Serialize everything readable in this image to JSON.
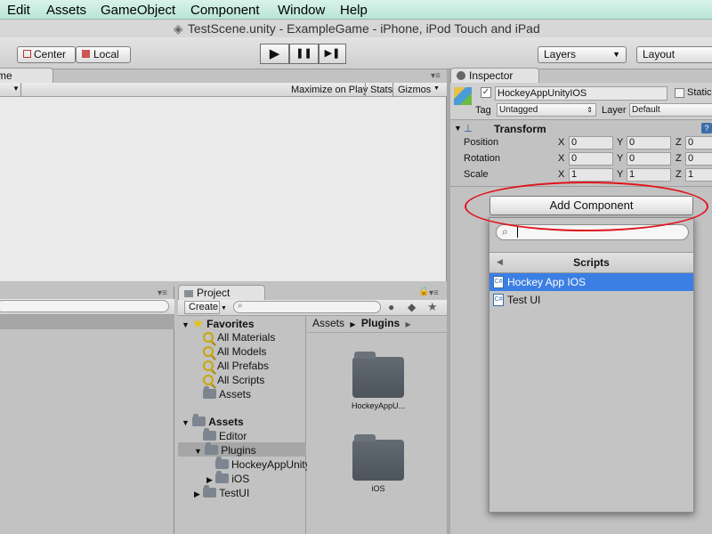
{
  "menubar": {
    "items": [
      "Edit",
      "Assets",
      "GameObject",
      "Component",
      "Window",
      "Help"
    ]
  },
  "window": {
    "title": "TestScene.unity - ExampleGame - iPhone, iPod Touch and iPad"
  },
  "toolbar": {
    "center_label": "Center",
    "local_label": "Local",
    "play": "▶",
    "pause": "❚❚",
    "step": "▶❚",
    "layers_label": "Layers",
    "layout_label": "Layout"
  },
  "game_view": {
    "tab_label": "me",
    "maximize_on_play": "Maximize on Play",
    "stats": "Stats",
    "gizmos": "Gizmos"
  },
  "project": {
    "tab_label": "Project",
    "create_label": "Create",
    "favorites_label": "Favorites",
    "favorites": [
      "All Materials",
      "All Models",
      "All Prefabs",
      "All Scripts",
      "Assets"
    ],
    "tree": {
      "assets": "Assets",
      "editor": "Editor",
      "plugins": "Plugins",
      "hockeyappunity": "HockeyAppUnity",
      "ios": "iOS",
      "testui": "TestUI"
    },
    "breadcrumb": {
      "root": "Assets",
      "sep": "▶",
      "current": "Plugins",
      "trail": "▶"
    },
    "items": [
      {
        "name": "HockeyAppU..."
      },
      {
        "name": "iOS"
      }
    ]
  },
  "inspector": {
    "tab_label": "Inspector",
    "object_name": "HockeyAppUnityIOS",
    "static_label": "Static",
    "tag_label": "Tag",
    "tag_value": "Untagged",
    "layer_label": "Layer",
    "layer_value": "Default",
    "transform": {
      "title": "Transform",
      "rows": [
        {
          "label": "Position",
          "x": "0",
          "y": "0",
          "z": "0"
        },
        {
          "label": "Rotation",
          "x": "0",
          "y": "0",
          "z": "0"
        },
        {
          "label": "Scale",
          "x": "1",
          "y": "1",
          "z": "1"
        }
      ],
      "x_label": "X",
      "y_label": "Y",
      "z_label": "Z"
    },
    "add_component_label": "Add Component",
    "popup": {
      "search_value": "",
      "header": "Scripts",
      "items": [
        {
          "label": "Hockey App IOS",
          "selected": true
        },
        {
          "label": "Test UI",
          "selected": false
        }
      ]
    }
  },
  "colors": {
    "selection": "#3b7fe4",
    "highlight_ring": "#e0141c"
  }
}
